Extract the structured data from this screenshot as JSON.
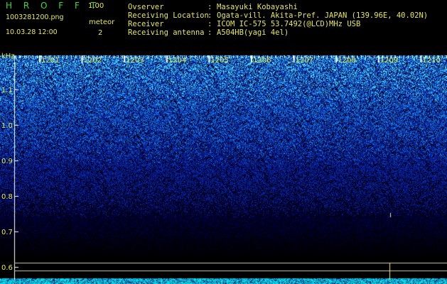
{
  "app": {
    "title": "H R O F F T",
    "version": "1.00"
  },
  "file": {
    "name": "1003281200.png",
    "datetime": "10.03.28 12:00"
  },
  "detect": {
    "mode": "meteor",
    "count": "2"
  },
  "info": [
    {
      "label": "Ovserver",
      "value": "Masayuki Kobayashi"
    },
    {
      "label": "Receiving Location",
      "value": "Ogata-vill. Akita-Pref. JAPAN (139.96E, 40.02N)"
    },
    {
      "label": "Receiver",
      "value": "ICOM IC-575 53.7492(@LCD)MHz USB"
    },
    {
      "label": "Receiving antenna",
      "value": "A504HB(yagi 4el)"
    }
  ],
  "axis": {
    "unit": "kHz",
    "y_labels": [
      "1.1",
      "1.0",
      "0.9",
      "0.8",
      "0.7",
      "0.6"
    ],
    "x_labels": [
      "1201",
      "1202",
      "1203",
      "1204",
      "1205",
      "1206",
      "1207",
      "1208",
      "1209",
      "1210"
    ]
  },
  "colors": {
    "text": "#e8e84a",
    "title": "#3cd93c",
    "tick": "#ffffff",
    "noise_high": "#3aa0ff",
    "baseline": "#00e5ff"
  }
}
